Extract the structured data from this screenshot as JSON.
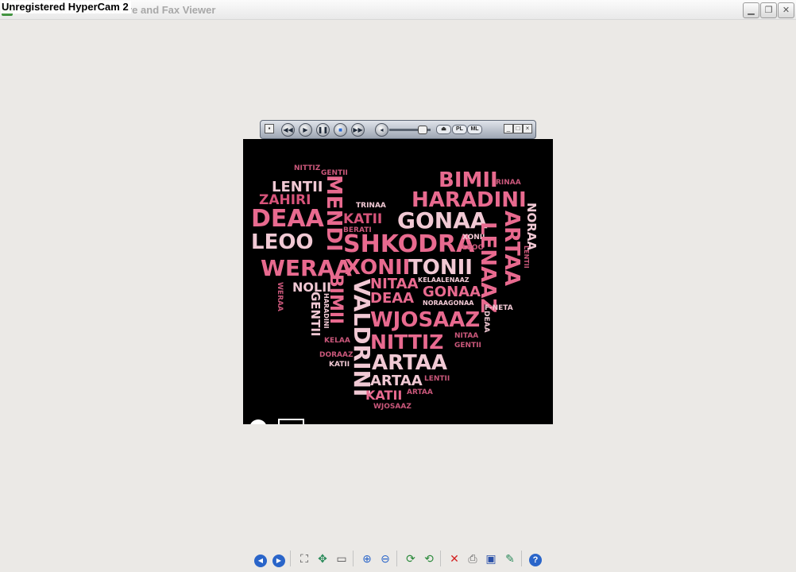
{
  "window": {
    "title": "Heart - Windows Picture and Fax Viewer",
    "watermark": "Unregistered HyperCam 2"
  },
  "mini_player": {
    "pl_label": "PL",
    "ml_label": "ML",
    "volume_level": 0.85
  },
  "wordcloud": {
    "words": [
      {
        "text": "NITTIZ",
        "color": "#c9577a"
      },
      {
        "text": "GENTII",
        "color": "#c9577a"
      },
      {
        "text": "LENTII",
        "color": "#f1c9d4"
      },
      {
        "text": "ZAHIRI",
        "color": "#d7547a"
      },
      {
        "text": "DEAA",
        "color": "#e86a8f"
      },
      {
        "text": "LEOO",
        "color": "#f1c9d4"
      },
      {
        "text": "WERAA",
        "color": "#e86a8f"
      },
      {
        "text": "MENDI",
        "color": "#e86a8f"
      },
      {
        "text": "KATII",
        "color": "#d7547a"
      },
      {
        "text": "BERATI",
        "color": "#c9577a"
      },
      {
        "text": "TRINAA",
        "color": "#f1c9d4"
      },
      {
        "text": "BIMII",
        "color": "#e86a8f"
      },
      {
        "text": "RINAA",
        "color": "#c9577a"
      },
      {
        "text": "HARADINI",
        "color": "#e86a8f"
      },
      {
        "text": "GONAA",
        "color": "#f1c9d4"
      },
      {
        "text": "SHKODRA",
        "color": "#e86a8f"
      },
      {
        "text": "XONII",
        "color": "#f1c9d4"
      },
      {
        "text": "LEOO",
        "color": "#c9577a"
      },
      {
        "text": "XONII",
        "color": "#e86a8f"
      },
      {
        "text": "TONII",
        "color": "#f1c9d4"
      },
      {
        "text": "ARTAA",
        "color": "#e86a8f"
      },
      {
        "text": "NORAA",
        "color": "#f1c9d4"
      },
      {
        "text": "LENAAZ",
        "color": "#e86a8f"
      },
      {
        "text": "NOLII",
        "color": "#f1c9d4"
      },
      {
        "text": "BIMII",
        "color": "#e86a8f"
      },
      {
        "text": "NITAA",
        "color": "#e86a8f"
      },
      {
        "text": "DEAA",
        "color": "#e86a8f"
      },
      {
        "text": "KELAALENAAZ",
        "color": "#f1c9d4"
      },
      {
        "text": "GONAA",
        "color": "#e86a8f"
      },
      {
        "text": "NORAAGONAA",
        "color": "#f1c9d4"
      },
      {
        "text": "F-NETA",
        "color": "#f1c9d4"
      },
      {
        "text": "VALDRINI",
        "color": "#f1c9d4"
      },
      {
        "text": "WJOSAAZ",
        "color": "#e86a8f"
      },
      {
        "text": "GENTII",
        "color": "#f1c9d4"
      },
      {
        "text": "HARADINI",
        "color": "#f1c9d4"
      },
      {
        "text": "NITTIZ",
        "color": "#e86a8f"
      },
      {
        "text": "NITAA",
        "color": "#c9577a"
      },
      {
        "text": "GENTII",
        "color": "#c9577a"
      },
      {
        "text": "DEAA",
        "color": "#f1c9d4"
      },
      {
        "text": "KELAA",
        "color": "#c9577a"
      },
      {
        "text": "DORAAZ",
        "color": "#c9577a"
      },
      {
        "text": "KATII",
        "color": "#f1c9d4"
      },
      {
        "text": "ARTAA",
        "color": "#f1c9d4"
      },
      {
        "text": "LENTII",
        "color": "#c9577a"
      },
      {
        "text": "ARTAA",
        "color": "#f1c9d4"
      },
      {
        "text": "ARTAA",
        "color": "#c9577a"
      },
      {
        "text": "KATII",
        "color": "#e86a8f"
      },
      {
        "text": "WJOSAAZ",
        "color": "#c9577a"
      },
      {
        "text": "WERAA",
        "color": "#c9577a"
      },
      {
        "text": "LENTII",
        "color": "#c9577a"
      }
    ]
  },
  "toolbar": {
    "buttons": [
      {
        "name": "previous-image-button",
        "icon": "arrow-left-icon",
        "glyph": "◀",
        "color": "#2a65c9"
      },
      {
        "name": "next-image-button",
        "icon": "arrow-right-icon",
        "glyph": "▶",
        "color": "#2a65c9"
      },
      {
        "name": "best-fit-button",
        "icon": "best-fit-icon",
        "glyph": "⛶",
        "color": "#4a4a4a"
      },
      {
        "name": "actual-size-button",
        "icon": "actual-size-icon",
        "glyph": "✥",
        "color": "#2a8a5a"
      },
      {
        "name": "slideshow-button",
        "icon": "slideshow-icon",
        "glyph": "▭",
        "color": "#555555"
      },
      {
        "name": "zoom-in-button",
        "icon": "zoom-in-icon",
        "glyph": "⊕",
        "color": "#2a65c9"
      },
      {
        "name": "zoom-out-button",
        "icon": "zoom-out-icon",
        "glyph": "⊖",
        "color": "#2a65c9"
      },
      {
        "name": "rotate-clockwise-button",
        "icon": "rotate-clockwise-icon",
        "glyph": "⟳",
        "color": "#2a8a3a"
      },
      {
        "name": "rotate-counterclockwise-button",
        "icon": "rotate-counterclockwise-icon",
        "glyph": "⟲",
        "color": "#2a8a3a"
      },
      {
        "name": "delete-button",
        "icon": "delete-icon",
        "glyph": "✕",
        "color": "#d32020"
      },
      {
        "name": "print-button",
        "icon": "print-icon",
        "glyph": "⎙",
        "color": "#666666"
      },
      {
        "name": "save-button",
        "icon": "save-icon",
        "glyph": "▣",
        "color": "#2a50a8"
      },
      {
        "name": "edit-button",
        "icon": "edit-icon",
        "glyph": "✎",
        "color": "#2a8a5a"
      },
      {
        "name": "help-button",
        "icon": "help-icon",
        "glyph": "?",
        "color": "#ffffff",
        "bg": "#2a65c9"
      }
    ]
  }
}
